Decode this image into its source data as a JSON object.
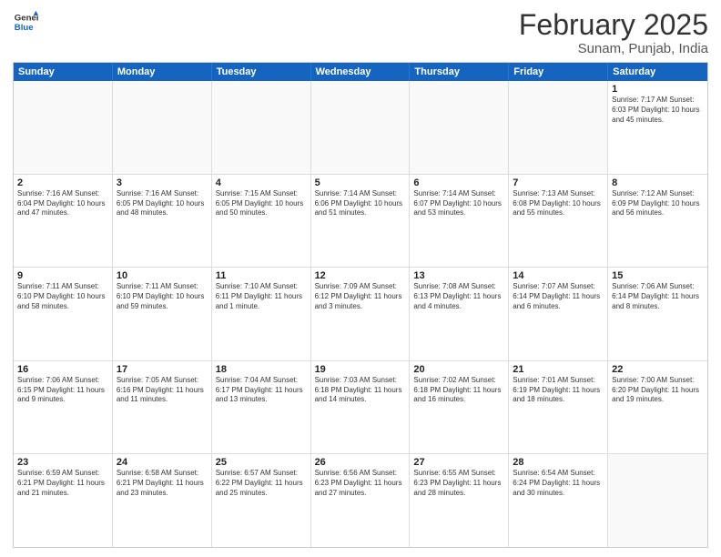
{
  "logo": {
    "general": "General",
    "blue": "Blue"
  },
  "header": {
    "month": "February 2025",
    "location": "Sunam, Punjab, India"
  },
  "weekdays": [
    "Sunday",
    "Monday",
    "Tuesday",
    "Wednesday",
    "Thursday",
    "Friday",
    "Saturday"
  ],
  "weeks": [
    [
      {
        "day": "",
        "detail": ""
      },
      {
        "day": "",
        "detail": ""
      },
      {
        "day": "",
        "detail": ""
      },
      {
        "day": "",
        "detail": ""
      },
      {
        "day": "",
        "detail": ""
      },
      {
        "day": "",
        "detail": ""
      },
      {
        "day": "1",
        "detail": "Sunrise: 7:17 AM\nSunset: 6:03 PM\nDaylight: 10 hours and 45 minutes."
      }
    ],
    [
      {
        "day": "2",
        "detail": "Sunrise: 7:16 AM\nSunset: 6:04 PM\nDaylight: 10 hours and 47 minutes."
      },
      {
        "day": "3",
        "detail": "Sunrise: 7:16 AM\nSunset: 6:05 PM\nDaylight: 10 hours and 48 minutes."
      },
      {
        "day": "4",
        "detail": "Sunrise: 7:15 AM\nSunset: 6:05 PM\nDaylight: 10 hours and 50 minutes."
      },
      {
        "day": "5",
        "detail": "Sunrise: 7:14 AM\nSunset: 6:06 PM\nDaylight: 10 hours and 51 minutes."
      },
      {
        "day": "6",
        "detail": "Sunrise: 7:14 AM\nSunset: 6:07 PM\nDaylight: 10 hours and 53 minutes."
      },
      {
        "day": "7",
        "detail": "Sunrise: 7:13 AM\nSunset: 6:08 PM\nDaylight: 10 hours and 55 minutes."
      },
      {
        "day": "8",
        "detail": "Sunrise: 7:12 AM\nSunset: 6:09 PM\nDaylight: 10 hours and 56 minutes."
      }
    ],
    [
      {
        "day": "9",
        "detail": "Sunrise: 7:11 AM\nSunset: 6:10 PM\nDaylight: 10 hours and 58 minutes."
      },
      {
        "day": "10",
        "detail": "Sunrise: 7:11 AM\nSunset: 6:10 PM\nDaylight: 10 hours and 59 minutes."
      },
      {
        "day": "11",
        "detail": "Sunrise: 7:10 AM\nSunset: 6:11 PM\nDaylight: 11 hours and 1 minute."
      },
      {
        "day": "12",
        "detail": "Sunrise: 7:09 AM\nSunset: 6:12 PM\nDaylight: 11 hours and 3 minutes."
      },
      {
        "day": "13",
        "detail": "Sunrise: 7:08 AM\nSunset: 6:13 PM\nDaylight: 11 hours and 4 minutes."
      },
      {
        "day": "14",
        "detail": "Sunrise: 7:07 AM\nSunset: 6:14 PM\nDaylight: 11 hours and 6 minutes."
      },
      {
        "day": "15",
        "detail": "Sunrise: 7:06 AM\nSunset: 6:14 PM\nDaylight: 11 hours and 8 minutes."
      }
    ],
    [
      {
        "day": "16",
        "detail": "Sunrise: 7:06 AM\nSunset: 6:15 PM\nDaylight: 11 hours and 9 minutes."
      },
      {
        "day": "17",
        "detail": "Sunrise: 7:05 AM\nSunset: 6:16 PM\nDaylight: 11 hours and 11 minutes."
      },
      {
        "day": "18",
        "detail": "Sunrise: 7:04 AM\nSunset: 6:17 PM\nDaylight: 11 hours and 13 minutes."
      },
      {
        "day": "19",
        "detail": "Sunrise: 7:03 AM\nSunset: 6:18 PM\nDaylight: 11 hours and 14 minutes."
      },
      {
        "day": "20",
        "detail": "Sunrise: 7:02 AM\nSunset: 6:18 PM\nDaylight: 11 hours and 16 minutes."
      },
      {
        "day": "21",
        "detail": "Sunrise: 7:01 AM\nSunset: 6:19 PM\nDaylight: 11 hours and 18 minutes."
      },
      {
        "day": "22",
        "detail": "Sunrise: 7:00 AM\nSunset: 6:20 PM\nDaylight: 11 hours and 19 minutes."
      }
    ],
    [
      {
        "day": "23",
        "detail": "Sunrise: 6:59 AM\nSunset: 6:21 PM\nDaylight: 11 hours and 21 minutes."
      },
      {
        "day": "24",
        "detail": "Sunrise: 6:58 AM\nSunset: 6:21 PM\nDaylight: 11 hours and 23 minutes."
      },
      {
        "day": "25",
        "detail": "Sunrise: 6:57 AM\nSunset: 6:22 PM\nDaylight: 11 hours and 25 minutes."
      },
      {
        "day": "26",
        "detail": "Sunrise: 6:56 AM\nSunset: 6:23 PM\nDaylight: 11 hours and 27 minutes."
      },
      {
        "day": "27",
        "detail": "Sunrise: 6:55 AM\nSunset: 6:23 PM\nDaylight: 11 hours and 28 minutes."
      },
      {
        "day": "28",
        "detail": "Sunrise: 6:54 AM\nSunset: 6:24 PM\nDaylight: 11 hours and 30 minutes."
      },
      {
        "day": "",
        "detail": ""
      }
    ]
  ]
}
